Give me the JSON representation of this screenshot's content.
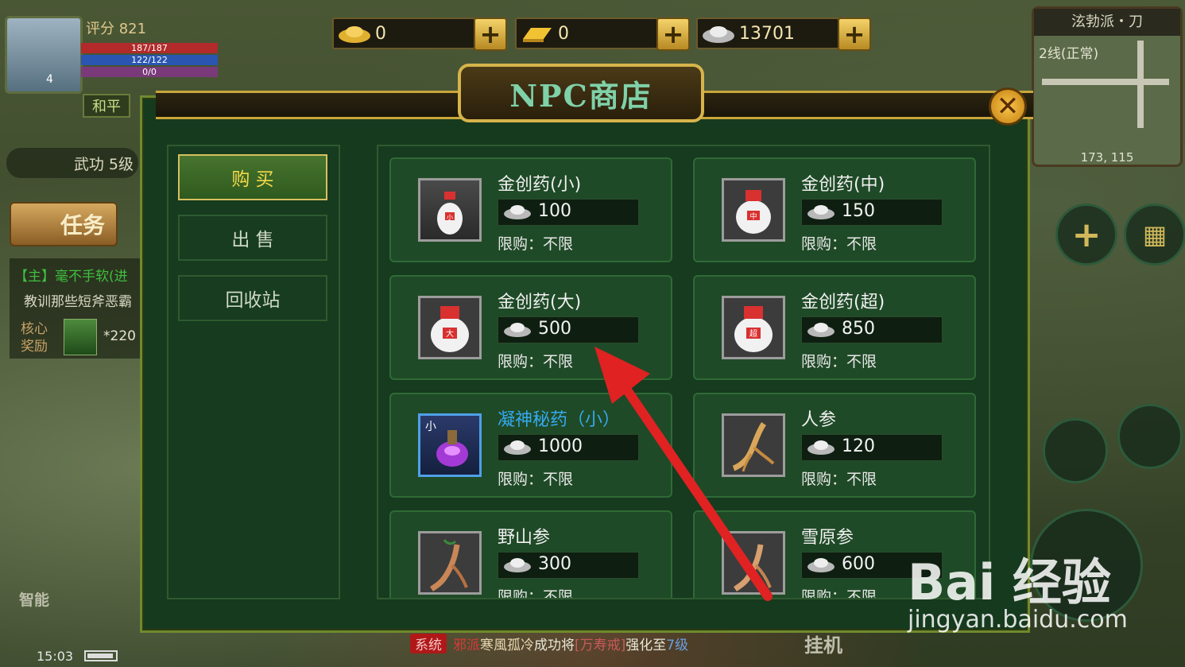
{
  "hud": {
    "score_label": "评分 821",
    "hp": "187/187",
    "mp": "122/122",
    "rage": "0/0",
    "level": "4",
    "mode": "和平",
    "martial": "武功 5级",
    "task_button": "任务",
    "quest_line1": "【主】毫不手软(进",
    "quest_line2": "教训那些短斧恶霸",
    "reward_label": "核心奖励",
    "reward_value": "*220",
    "auto_label": "智能",
    "time": "15:03",
    "afk_label": "挂机"
  },
  "currency": [
    {
      "icon": "gold-ingot-icon",
      "value": "0"
    },
    {
      "icon": "gold-bar-icon",
      "value": "0"
    },
    {
      "icon": "silver-ingot-icon",
      "value": "13701"
    }
  ],
  "minimap": {
    "title": "泫勃派・刀",
    "line": "2线(正常)",
    "coord": "173, 115"
  },
  "shop": {
    "title": "NPC商店",
    "tabs": [
      {
        "label": "购  买",
        "active": true
      },
      {
        "label": "出  售",
        "active": false
      },
      {
        "label": "回收站",
        "active": false
      }
    ],
    "items": [
      {
        "name": "金创药(小)",
        "price": "100",
        "limit": "限购：不限",
        "icon": "small-medicine-jar-icon",
        "mark": "小"
      },
      {
        "name": "金创药(中)",
        "price": "150",
        "limit": "限购：不限",
        "icon": "medium-medicine-jar-icon",
        "mark": "中"
      },
      {
        "name": "金创药(大)",
        "price": "500",
        "limit": "限购：不限",
        "icon": "large-medicine-jar-icon",
        "mark": "大"
      },
      {
        "name": "金创药(超)",
        "price": "850",
        "limit": "限购：不限",
        "icon": "super-medicine-jar-icon",
        "mark": "超"
      },
      {
        "name": "凝神秘药（小）",
        "price": "1000",
        "limit": "限购：不限",
        "icon": "potion-bottle-icon",
        "mark": "小"
      },
      {
        "name": "人参",
        "price": "120",
        "limit": "限购：不限",
        "icon": "ginseng-icon"
      },
      {
        "name": "野山参",
        "price": "300",
        "limit": "限购：不限",
        "icon": "wild-ginseng-icon"
      },
      {
        "name": "雪原参",
        "price": "600",
        "limit": "限购：不限",
        "icon": "snow-ginseng-icon"
      }
    ]
  },
  "chat": {
    "channel": "系统",
    "part1": "邪派",
    "part2": "寒風孤冷",
    "part3": "成功将",
    "part4": "[万寿戒]",
    "part5": "强化至",
    "part6": "7级"
  },
  "watermark": {
    "logo": "Bai 经验",
    "url": "jingyan.baidu.com"
  }
}
